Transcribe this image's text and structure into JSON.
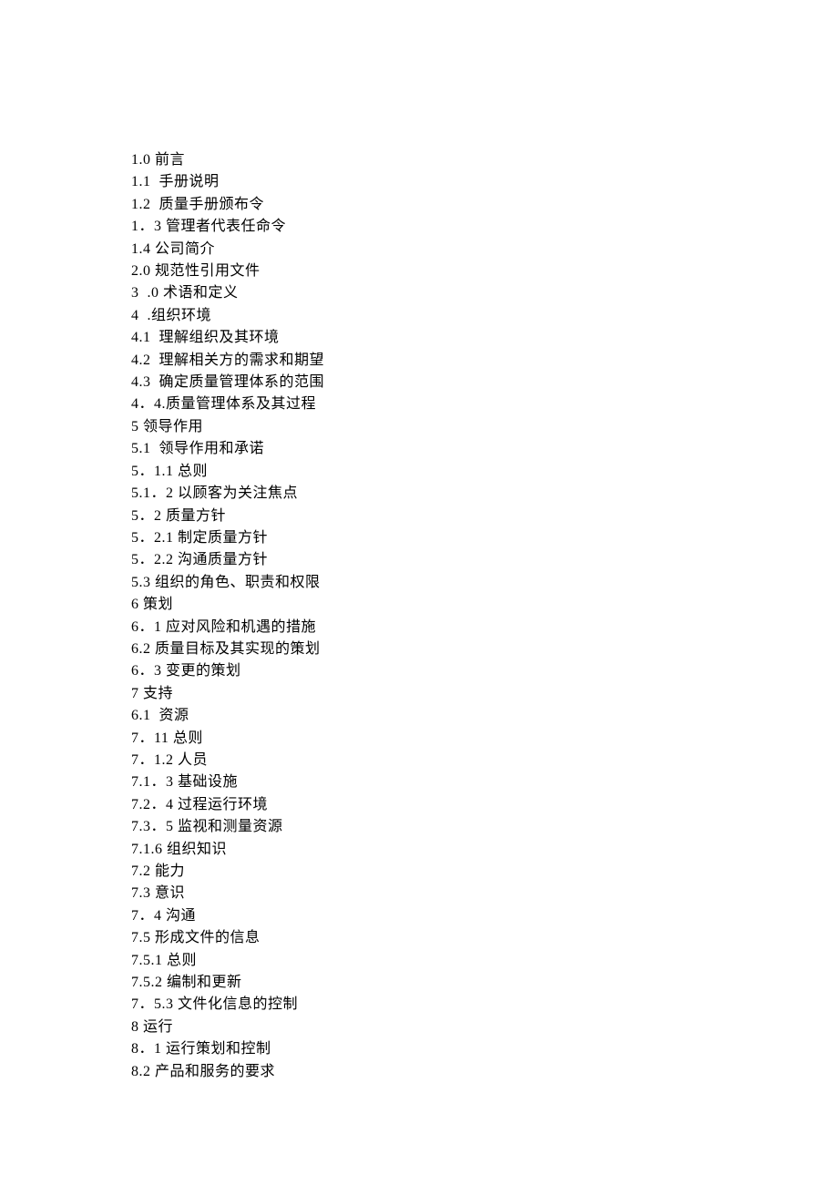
{
  "toc": {
    "lines": [
      "1.0 前言",
      "1.1  手册说明",
      "1.2  质量手册颁布令",
      "1．3 管理者代表任命令",
      "1.4 公司简介",
      "2.0 规范性引用文件",
      "3  .0 术语和定义",
      "4  .组织环境",
      "4.1  理解组织及其环境",
      "4.2  理解相关方的需求和期望",
      "4.3  确定质量管理体系的范围",
      "4．4.质量管理体系及其过程",
      "5 领导作用",
      "5.1  领导作用和承诺",
      "5．1.1 总则",
      "5.1．2 以顾客为关注焦点",
      "5．2 质量方针",
      "5．2.1 制定质量方针",
      "5．2.2 沟通质量方针",
      "5.3 组织的角色、职责和权限",
      "6 策划",
      "6．1 应对风险和机遇的措施",
      "6.2 质量目标及其实现的策划",
      "6．3 变更的策划",
      "7 支持",
      "6.1  资源",
      "7．11 总则",
      "7．1.2 人员",
      "7.1．3 基础设施",
      "7.2．4 过程运行环境",
      "7.3．5 监视和测量资源",
      "7.1.6 组织知识",
      "7.2 能力",
      "7.3 意识",
      "7．4 沟通",
      "7.5 形成文件的信息",
      "7.5.1 总则",
      "7.5.2 编制和更新",
      "7．5.3 文件化信息的控制",
      "8 运行",
      "8．1 运行策划和控制",
      "8.2 产品和服务的要求"
    ]
  }
}
